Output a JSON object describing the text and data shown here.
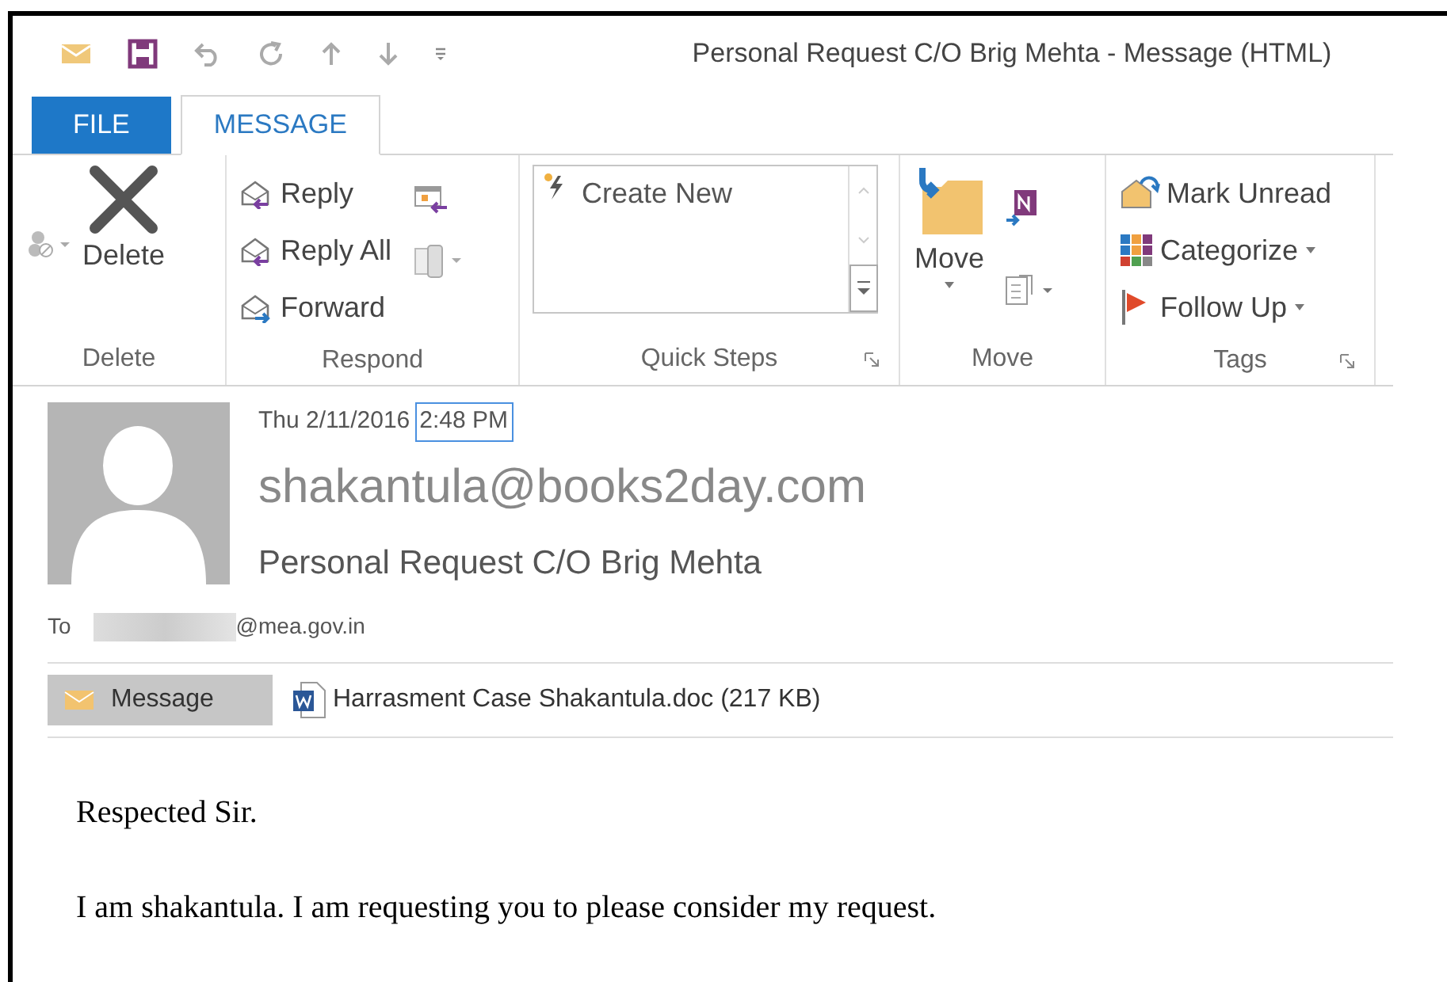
{
  "window": {
    "title": "Personal Request C/O Brig Mehta - Message (HTML)"
  },
  "tabs": [
    {
      "label": "FILE",
      "kind": "file",
      "selected": false
    },
    {
      "label": "MESSAGE",
      "kind": "tab",
      "selected": true
    }
  ],
  "ribbon": {
    "groups": [
      {
        "label": "Delete",
        "items": [
          {
            "label": "Delete"
          }
        ]
      },
      {
        "label": "Respond",
        "items": [
          {
            "label": "Reply"
          },
          {
            "label": "Reply All"
          },
          {
            "label": "Forward"
          }
        ]
      },
      {
        "label": "Quick Steps",
        "items": [
          {
            "label": "Create New"
          }
        ]
      },
      {
        "label": "Move",
        "items": [
          {
            "label": "Move"
          }
        ]
      },
      {
        "label": "Tags",
        "items": [
          {
            "label": "Mark Unread"
          },
          {
            "label": "Categorize"
          },
          {
            "label": "Follow Up"
          }
        ]
      }
    ]
  },
  "header": {
    "date": "Thu 2/11/2016",
    "time": {
      "text": "2:48 PM",
      "selected": true
    },
    "sender": "shakantula@books2day.com",
    "subject": "Personal Request C/O Brig Mehta",
    "to_label": "To",
    "to_address": "@mea.gov.in"
  },
  "attachments": [
    {
      "label": "Message",
      "kind": "message",
      "selected": true
    },
    {
      "label": "Harrasment Case Shakantula.doc (217 KB)",
      "kind": "file",
      "selected": false
    }
  ],
  "body": [
    "Respected Sir.",
    "I am shakantula. I am requesting you to please consider my request."
  ]
}
